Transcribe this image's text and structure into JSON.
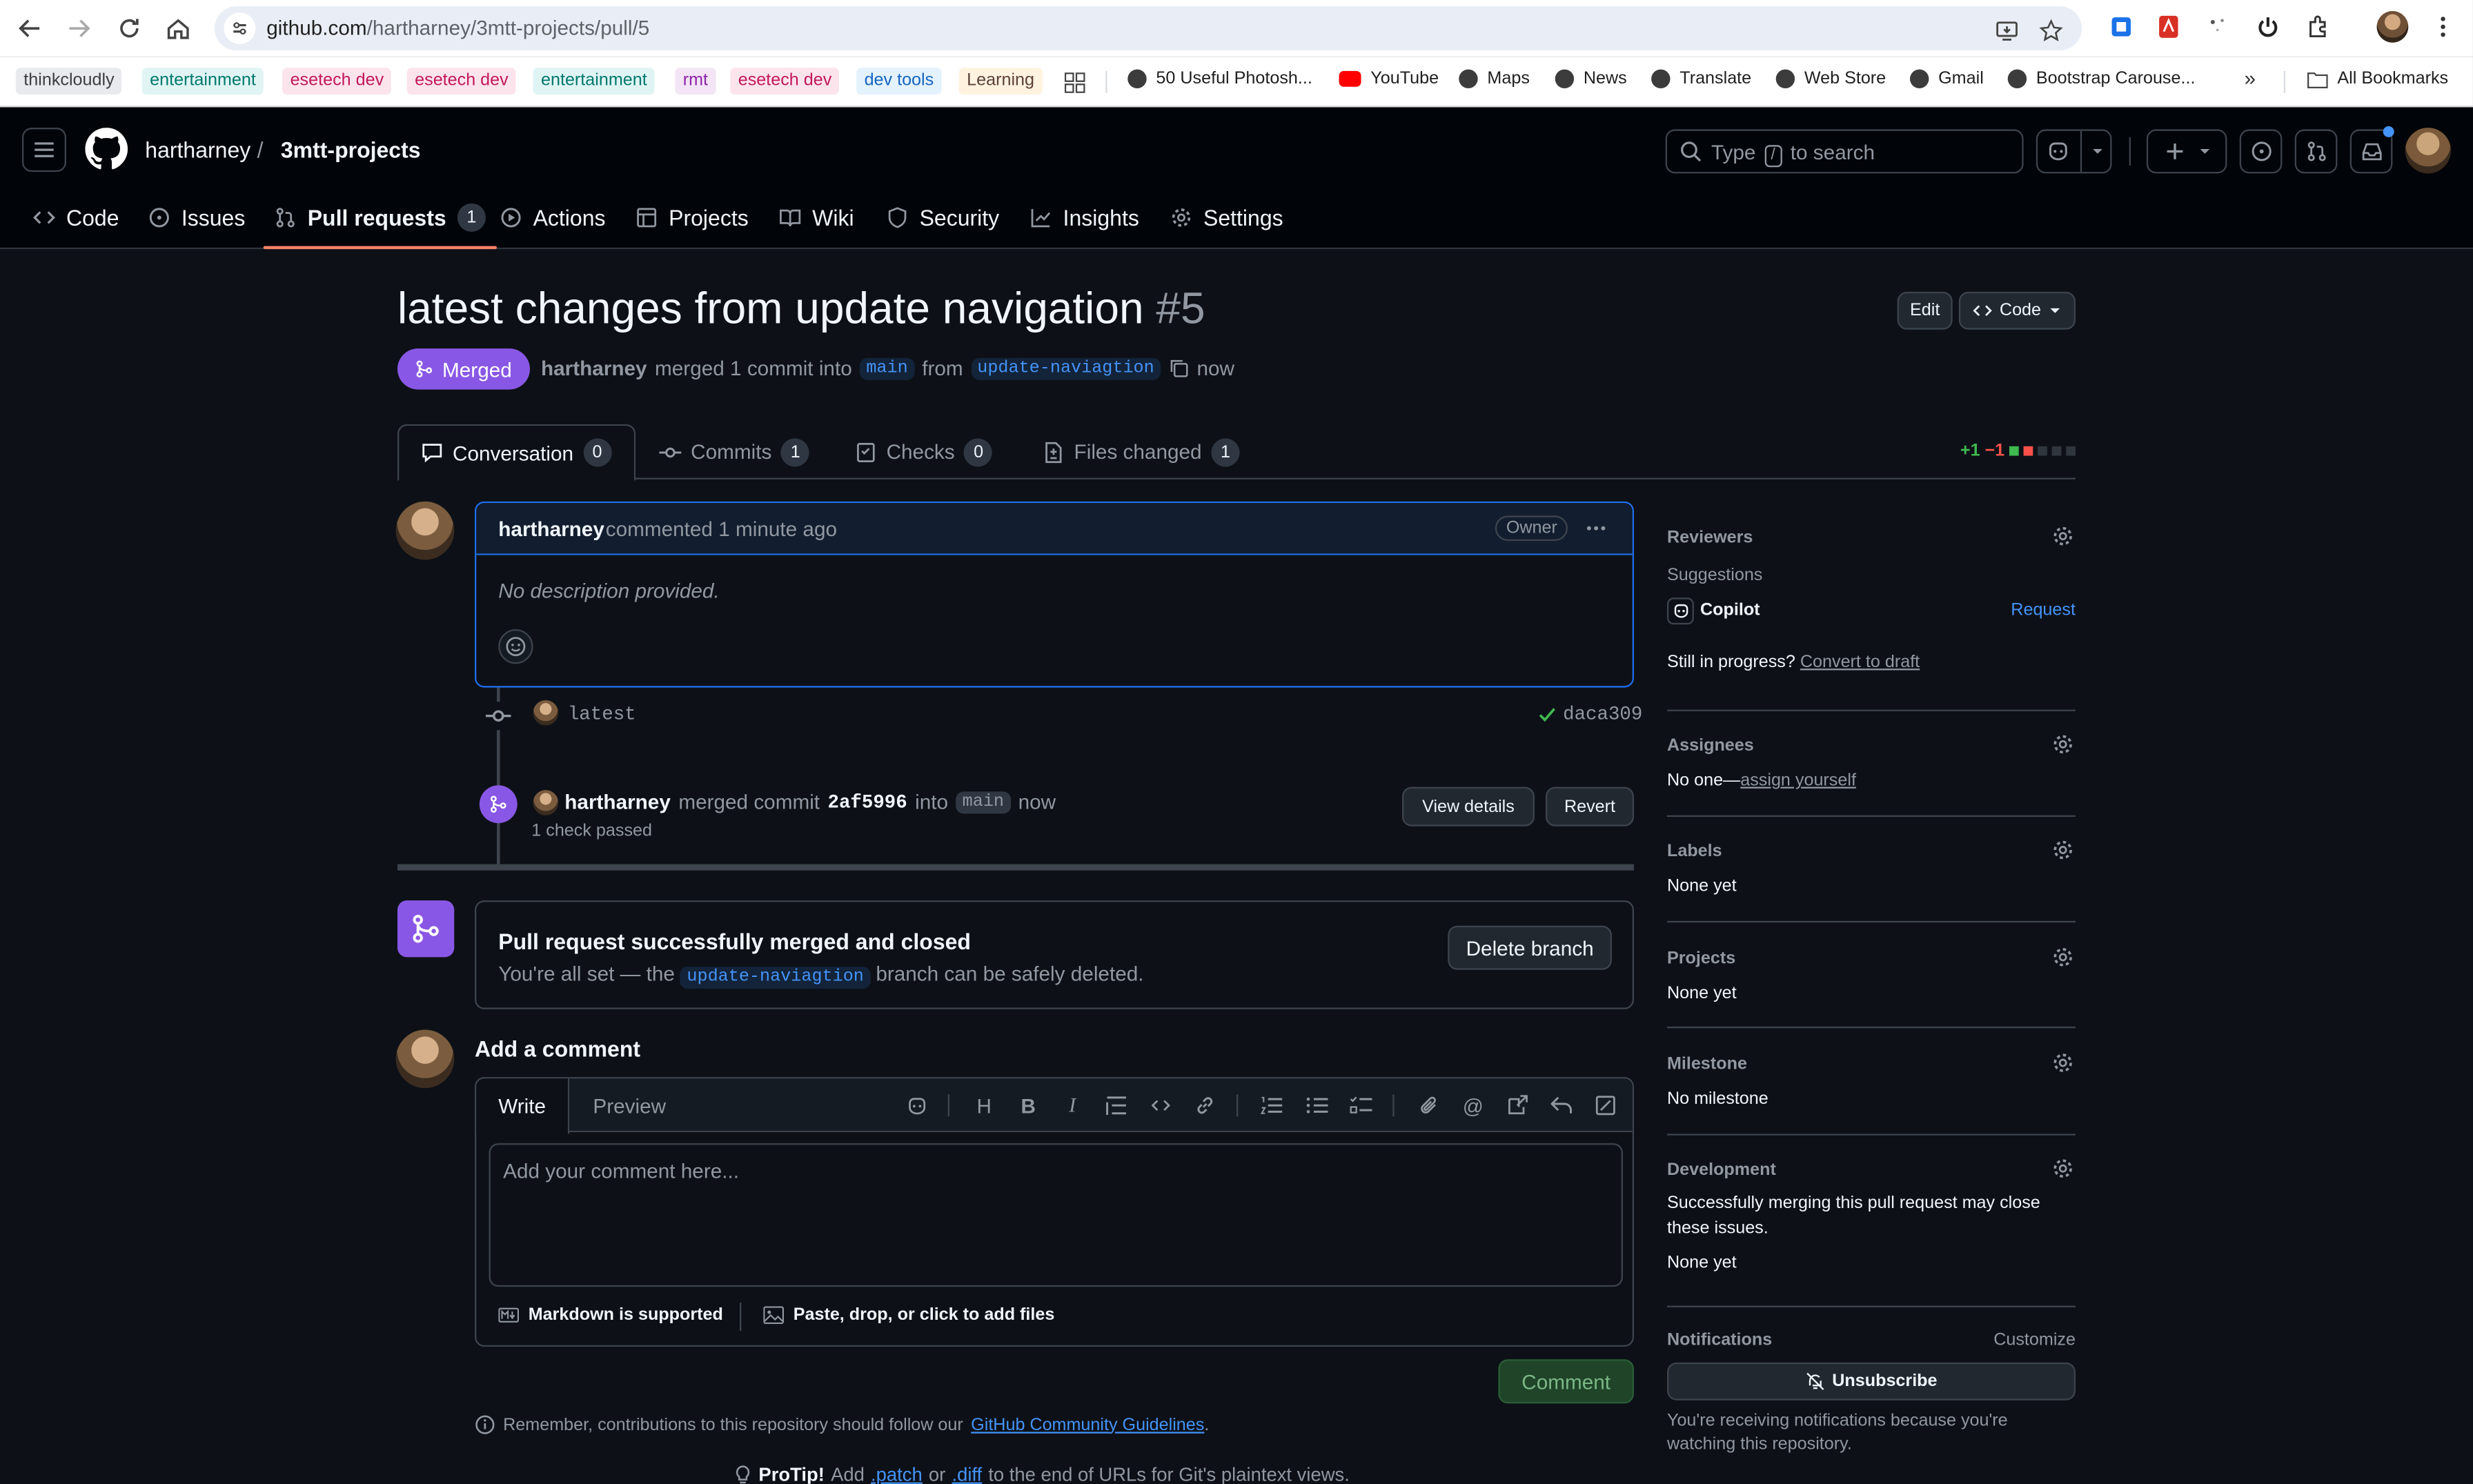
{
  "browser": {
    "url_host": "github.com",
    "url_path": "/hartharney/3mtt-projects/pull/5",
    "bookmark_tags": [
      {
        "label": "thinkcloudly",
        "bg": "#e8eaed",
        "fg": "#3c4043"
      },
      {
        "label": "entertainment",
        "bg": "#e0f4f4",
        "fg": "#00796b"
      },
      {
        "label": "esetech dev",
        "bg": "#fce4ec",
        "fg": "#c2185b"
      },
      {
        "label": "esetech dev",
        "bg": "#fce4ec",
        "fg": "#c2185b"
      },
      {
        "label": "entertainment",
        "bg": "#e0f4f4",
        "fg": "#00796b"
      },
      {
        "label": "rmt",
        "bg": "#f3e5f5",
        "fg": "#8e24aa"
      },
      {
        "label": "esetech dev",
        "bg": "#fce4ec",
        "fg": "#c2185b"
      },
      {
        "label": "dev tools",
        "bg": "#e3f2fd",
        "fg": "#1565c0"
      },
      {
        "label": "Learning",
        "bg": "#fff3e0",
        "fg": "#5d4037"
      }
    ],
    "bookmark_links": [
      "50 Useful Photosh...",
      "YouTube",
      "Maps",
      "News",
      "Translate",
      "Web Store",
      "Gmail",
      "Bootstrap Carouse..."
    ],
    "all_bookmarks": "All Bookmarks"
  },
  "header": {
    "owner": "hartharney",
    "separator": "/",
    "repo": "3mtt-projects",
    "search_prefix": "Type",
    "search_key": "/",
    "search_suffix": "to search"
  },
  "repo_tabs": [
    {
      "label": "Code",
      "icon": "code-icon"
    },
    {
      "label": "Issues",
      "icon": "issue-icon"
    },
    {
      "label": "Pull requests",
      "icon": "pull-request-icon",
      "count": "1",
      "active": true
    },
    {
      "label": "Actions",
      "icon": "play-icon"
    },
    {
      "label": "Projects",
      "icon": "table-icon"
    },
    {
      "label": "Wiki",
      "icon": "book-icon"
    },
    {
      "label": "Security",
      "icon": "shield-icon"
    },
    {
      "label": "Insights",
      "icon": "graph-icon"
    },
    {
      "label": "Settings",
      "icon": "gear-icon"
    }
  ],
  "pr": {
    "title": "latest changes from update navigation",
    "number": "#5",
    "edit_label": "Edit",
    "code_label": "Code",
    "state": "Merged",
    "author": "hartharney",
    "merged_text": "merged 1 commit into",
    "base_branch": "main",
    "from_text": "from",
    "head_branch": "update-naviagtion",
    "time": "now",
    "tabs": [
      {
        "label": "Conversation",
        "count": "0",
        "icon": "comment-icon"
      },
      {
        "label": "Commits",
        "count": "1",
        "icon": "commit-icon"
      },
      {
        "label": "Checks",
        "count": "0",
        "icon": "checklist-icon"
      },
      {
        "label": "Files changed",
        "count": "1",
        "icon": "file-diff-icon"
      }
    ],
    "diff_add": "+1",
    "diff_del": "−1"
  },
  "comment": {
    "author": "hartharney",
    "time": "commented 1 minute ago",
    "badge": "Owner",
    "body": "No description provided."
  },
  "commit": {
    "message": "latest",
    "sha": "daca309"
  },
  "merge_event": {
    "author": "hartharney",
    "text": "merged commit",
    "sha": "2af5996",
    "into": "into",
    "branch": "main",
    "time": "now",
    "checks": "1 check passed",
    "view_details": "View details",
    "revert": "Revert"
  },
  "merge_box": {
    "title": "Pull request successfully merged and closed",
    "sub_prefix": "You're all set — the",
    "branch": "update-naviagtion",
    "sub_suffix": "branch can be safely deleted.",
    "delete_label": "Delete branch"
  },
  "add_comment": {
    "title": "Add a comment",
    "write_tab": "Write",
    "preview_tab": "Preview",
    "placeholder": "Add your comment here...",
    "markdown_note": "Markdown is supported",
    "attach_note": "Paste, drop, or click to add files",
    "submit": "Comment",
    "guidelines_prefix": "Remember, contributions to this repository should follow our",
    "guidelines_link": "GitHub Community Guidelines",
    "guidelines_suffix": ".",
    "protip_label": "ProTip!",
    "protip_1": "Add",
    "protip_patch": ".patch",
    "protip_or": "or",
    "protip_diff": ".diff",
    "protip_2": "to the end of URLs for Git's plaintext views."
  },
  "sidebar": {
    "reviewers": {
      "title": "Reviewers",
      "suggestions": "Suggestions",
      "copilot": "Copilot",
      "request": "Request",
      "draft_prefix": "Still in progress?",
      "draft_link": "Convert to draft"
    },
    "assignees": {
      "title": "Assignees",
      "prefix": "No one—",
      "link": "assign yourself"
    },
    "labels": {
      "title": "Labels",
      "value": "None yet"
    },
    "projects": {
      "title": "Projects",
      "value": "None yet"
    },
    "milestone": {
      "title": "Milestone",
      "value": "No milestone"
    },
    "development": {
      "title": "Development",
      "desc": "Successfully merging this pull request may close these issues.",
      "value": "None yet"
    },
    "notifications": {
      "title": "Notifications",
      "customize": "Customize",
      "unsubscribe": "Unsubscribe",
      "note": "You're receiving notifications because you're watching this repository."
    }
  },
  "colors": {
    "merged_purple": "#8957e5",
    "link_blue": "#4493f8",
    "background": "#0d1117",
    "success_green": "#3fb950",
    "danger_red": "#f85149"
  }
}
